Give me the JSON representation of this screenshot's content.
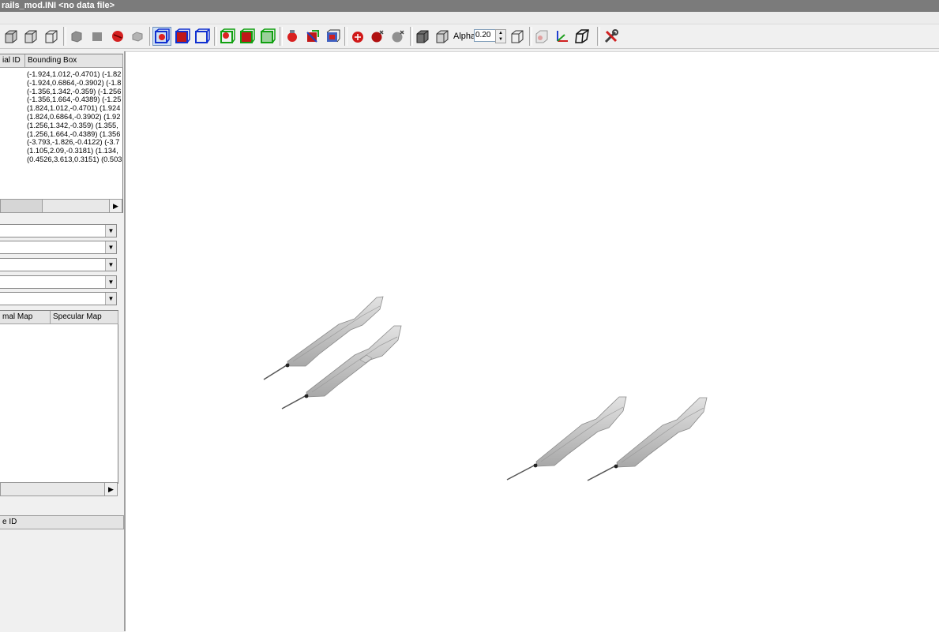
{
  "window": {
    "title": "rails_mod.INI  <no data file>"
  },
  "toolbar": {
    "icons": [
      "view-box-icon",
      "view-box-icon",
      "view-box-icon",
      "solid-shaded-icon",
      "solid-flat-icon",
      "solid-red-icon",
      "solid-grey-icon",
      "select-blue-box-icon",
      "select-blue-red-icon",
      "select-blue-outline-icon",
      "select-green-red-icon",
      "select-green-solid-icon",
      "select-green-outline-icon",
      "material-red-icon",
      "material-color-icon",
      "material-multi-icon",
      "sphere-red-icon",
      "sphere-dark-icon",
      "sphere-light-icon",
      "cube-dark-icon",
      "cube-outline-icon",
      "alpha-box-icon",
      "alpha-cube-icon",
      "axes-icon",
      "perspective-box-icon",
      "tools-icon"
    ],
    "alpha_label": "Alpha:",
    "alpha_value": "0.20"
  },
  "mesh_table": {
    "columns": [
      "ial ID",
      "Bounding Box"
    ],
    "rows": [
      "(-1.924,1.012,-0.4701) (-1.82",
      "(-1.924,0.6864,-0.3902) (-1.8",
      "(-1.356,1.342,-0.359) (-1.256",
      "(-1.356,1.664,-0.4389) (-1.25",
      "(1.824,1.012,-0.4701) (1.924",
      "(1.824,0.6864,-0.3902) (1.92",
      "(1.256,1.342,-0.359) (1.355,",
      "(1.256,1.664,-0.4389) (1.356",
      "(-3.793,-1.826,-0.4122) (-3.7",
      "(1.105,2.09,-0.3181) (1.134,",
      "(0.4526,3.613,0.3151) (0.503"
    ]
  },
  "material_table": {
    "columns": [
      "mal Map",
      "Specular Map"
    ]
  },
  "texture_table": {
    "columns": [
      "e ID"
    ]
  },
  "dropdowns": [
    "",
    "",
    "",
    "",
    ""
  ]
}
